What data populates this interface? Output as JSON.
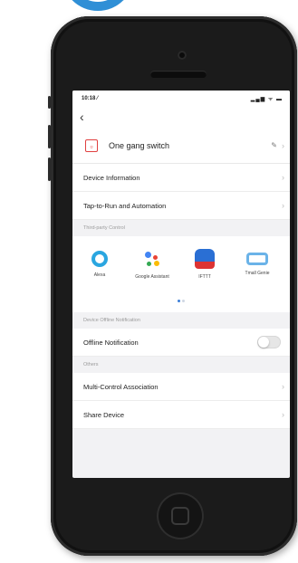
{
  "status_bar": {
    "time": "10:18 ⁄",
    "icons": "▂▄▆ ᯤ ▬"
  },
  "device": {
    "name": "One gang switch"
  },
  "menu": [
    {
      "label": "Device Information"
    },
    {
      "label": "Tap-to-Run and Automation"
    }
  ],
  "third_party": {
    "section_title": "Third-party Control",
    "items": [
      {
        "label": "Alexa"
      },
      {
        "label": "Google Assistant"
      },
      {
        "label": "IFTTT"
      },
      {
        "label": "Tmall Genie"
      }
    ]
  },
  "offline": {
    "section_title": "Device Offline Notification",
    "label": "Offline Notification",
    "enabled": false
  },
  "others": {
    "section_title": "Others",
    "items": [
      {
        "label": "Multi-Control Association"
      },
      {
        "label": "Share Device"
      }
    ]
  },
  "colors": {
    "phone_body": "#1b1b1b",
    "accent_blue": "#3c7fd8",
    "device_icon_red": "#e04040"
  }
}
